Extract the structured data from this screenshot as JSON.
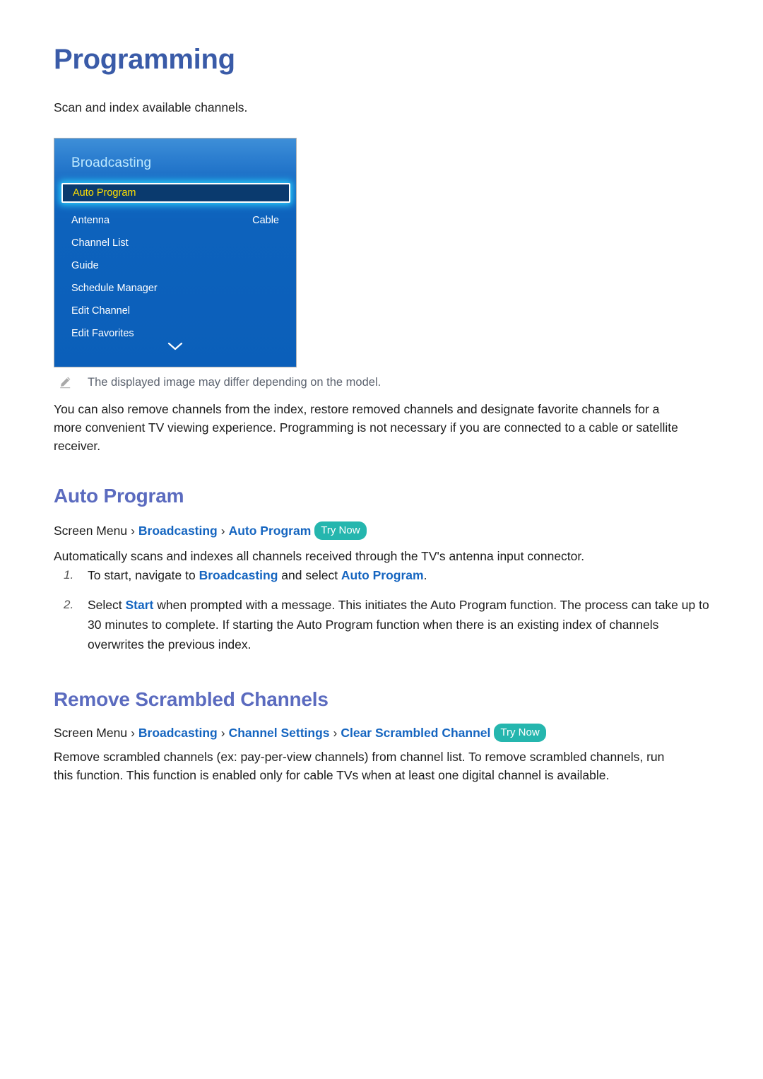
{
  "document": {
    "title": "Programming",
    "intro": "Scan and index available channels."
  },
  "tv_menu": {
    "header": "Broadcasting",
    "selected_item": "Auto Program",
    "items": [
      {
        "label": "Antenna",
        "value": "Cable"
      },
      {
        "label": "Channel List",
        "value": ""
      },
      {
        "label": "Guide",
        "value": ""
      },
      {
        "label": "Schedule Manager",
        "value": ""
      },
      {
        "label": "Edit Channel",
        "value": ""
      },
      {
        "label": "Edit Favorites",
        "value": ""
      }
    ],
    "scroll_indicator": "chevron-down-icon",
    "colors": {
      "panel_blue": "#0b5fba",
      "panel_blue_top": "#3e8fd8",
      "header_text": "#bfeaff",
      "highlight_fill": "#0a3a6e",
      "highlight_glow": "#2ad2ff",
      "highlight_text": "#ffe000"
    }
  },
  "note": {
    "icon": "pencil-icon",
    "text": "The displayed image may differ depending on the model."
  },
  "paragraphs": {
    "intro_body": "You can also remove channels from the index, restore removed channels and designate favorite channels for a more convenient TV viewing experience. Programming is not necessary if you are connected to a cable or satellite receiver.",
    "auto_program_body": "Automatically scans and indexes all channels received through the TV's antenna input connector.",
    "scrambled_body": "Remove scrambled channels (ex: pay-per-view channels) from channel list. To remove scrambled channels, run this function. This function is enabled only for cable TVs when at least one digital channel is available."
  },
  "sections": {
    "auto_program": {
      "heading": "Auto Program",
      "breadcrumb": {
        "root": "Screen Menu",
        "separator": "›",
        "links": [
          "Broadcasting",
          "Auto Program"
        ],
        "badge": "Try Now"
      },
      "steps": [
        {
          "number": "1.",
          "parts": [
            {
              "text": "To start, navigate to ",
              "style": "plain"
            },
            {
              "text": "Broadcasting",
              "style": "link"
            },
            {
              "text": " and select ",
              "style": "plain"
            },
            {
              "text": "Auto Program",
              "style": "link"
            },
            {
              "text": ".",
              "style": "plain"
            }
          ]
        },
        {
          "number": "2.",
          "parts": [
            {
              "text": "Select ",
              "style": "plain"
            },
            {
              "text": "Start",
              "style": "link"
            },
            {
              "text": " when prompted with a message. This initiates the Auto Program function. The process can take up to 30 minutes to complete. If starting the Auto Program function when there is an existing index of channels overwrites the previous index.",
              "style": "plain"
            }
          ]
        }
      ]
    },
    "remove_scrambled": {
      "heading": "Remove Scrambled Channels",
      "breadcrumb": {
        "root": "Screen Menu",
        "separator": "›",
        "links": [
          "Broadcasting",
          "Channel Settings",
          "Clear Scrambled Channel"
        ],
        "badge": "Try Now"
      }
    }
  },
  "theme": {
    "title_blue": "#3a5ba8",
    "heading_blue": "#5b6bbf",
    "link_blue": "#1565c0",
    "badge_teal": "#25b6ae",
    "note_gray": "#5d6470"
  }
}
